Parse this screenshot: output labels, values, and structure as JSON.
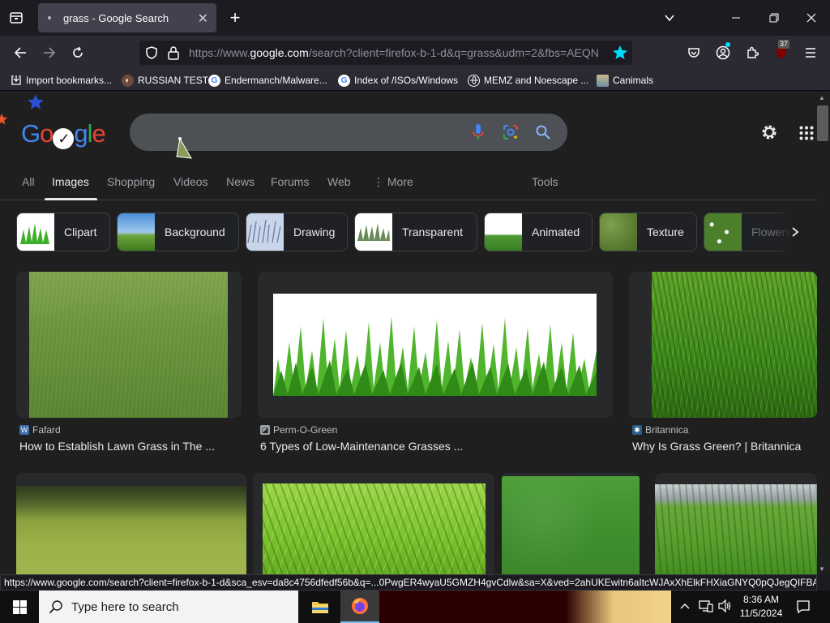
{
  "browser": {
    "tab_title": "grass - Google Search",
    "url_host_prefix": "https://www.",
    "url_host": "google.com",
    "url_rest": "/search?client=firefox-b-1-d&q=grass&udm=2&fbs=AEQN",
    "extension_badge": "37",
    "bookmarks": [
      {
        "label": "Import bookmarks...",
        "icon": "import-icon"
      },
      {
        "label": "RUSSIAN TEST",
        "icon": "github-icon"
      },
      {
        "label": "Endermanch/Malware...",
        "icon": "google-icon"
      },
      {
        "label": "Index of /ISOs/Windows",
        "icon": "google-icon"
      },
      {
        "label": "MEMZ and Noescape ...",
        "icon": "globe-icon"
      },
      {
        "label": "Canimals",
        "icon": "image-icon"
      }
    ],
    "status_url": "https://www.google.com/search?client=firefox-b-1-d&sca_esv=da8c4756dfedf56b&q=...0PwgER4wyaU5GMZH4gvCdlw&sa=X&ved=2ahUKEwitn6aItcWJAxXhElkFHXiaGNYQ0pQJegQIFBAB"
  },
  "google": {
    "logo_letters": [
      "G",
      "o",
      "o",
      "g",
      "l",
      "e"
    ],
    "nav": [
      "All",
      "Images",
      "Shopping",
      "Videos",
      "News",
      "Forums",
      "Web"
    ],
    "more_label": "More",
    "tools_label": "Tools",
    "chips": [
      "Clipart",
      "Background",
      "Drawing",
      "Transparent",
      "Animated",
      "Texture",
      "Flowers"
    ],
    "results": [
      {
        "source": "Fafard",
        "caption": "How to Establish Lawn Grass in The ..."
      },
      {
        "source": "Perm-O-Green",
        "caption": "6 Types of Low-Maintenance Grasses ..."
      },
      {
        "source": "Britannica",
        "caption": "Why Is Grass Green? | Britannica"
      }
    ]
  },
  "taskbar": {
    "search_placeholder": "Type here to search",
    "time": "8:36 AM",
    "date": "11/5/2024"
  },
  "colors": {
    "google_blue": "#4285f4",
    "google_red": "#ea4335",
    "google_yellow": "#fbbc05",
    "google_green": "#34a853",
    "bookmark_star": "#00ddff"
  }
}
